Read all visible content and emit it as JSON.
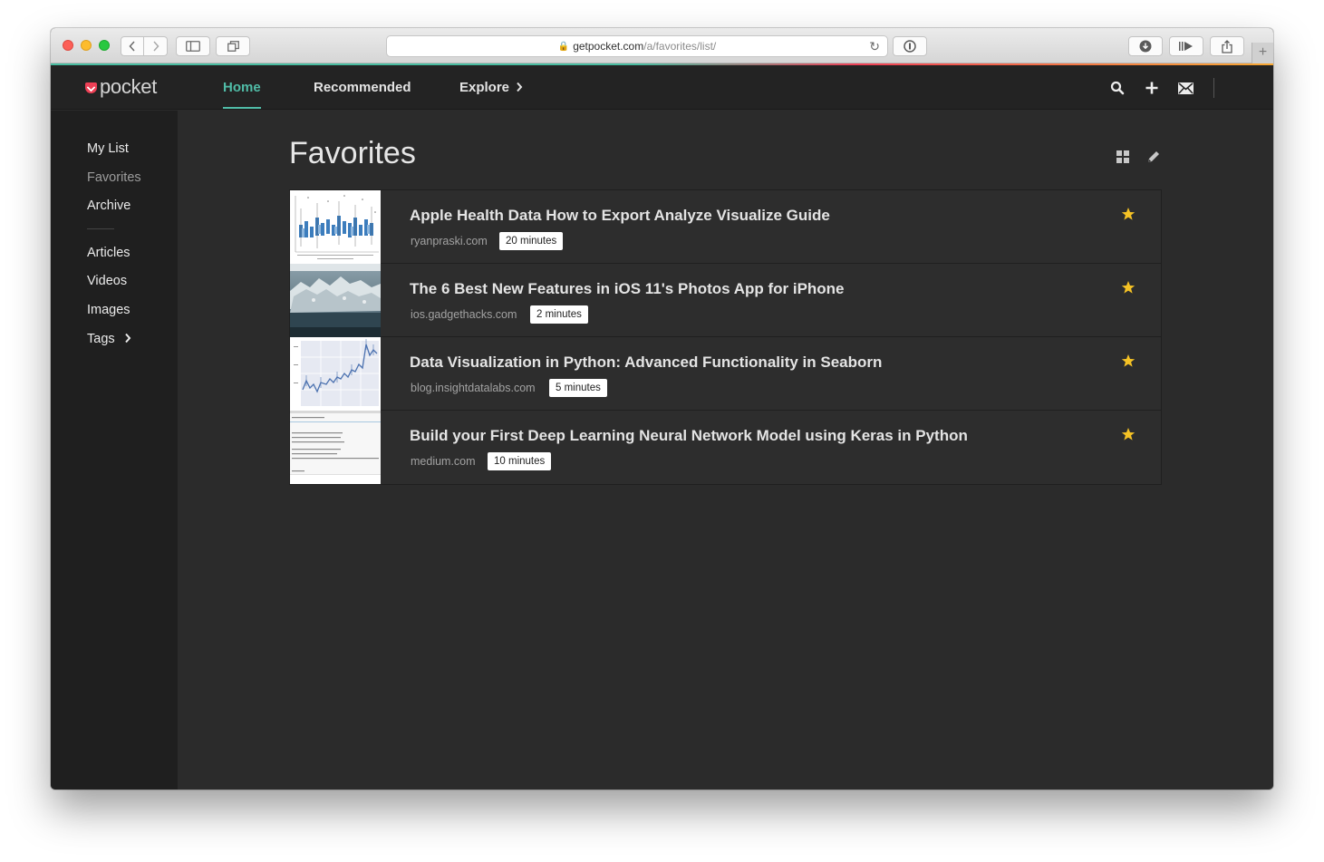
{
  "browser": {
    "url_host": "getpocket.com",
    "url_path": "/a/favorites/list/"
  },
  "header": {
    "logo_text": "pocket",
    "nav": [
      {
        "label": "Home",
        "active": true
      },
      {
        "label": "Recommended",
        "active": false
      },
      {
        "label": "Explore",
        "active": false
      }
    ],
    "icons": [
      "search-icon",
      "add-icon",
      "mail-icon"
    ]
  },
  "sidebar": {
    "primary": [
      {
        "label": "My List"
      },
      {
        "label": "Favorites",
        "selected": true
      },
      {
        "label": "Archive"
      }
    ],
    "filters": [
      {
        "label": "Articles"
      },
      {
        "label": "Videos"
      },
      {
        "label": "Images"
      },
      {
        "label": "Tags"
      }
    ]
  },
  "main": {
    "page_title": "Favorites",
    "items": [
      {
        "title": "Apple Health Data How to Export Analyze Visualize Guide",
        "domain": "ryanpraski.com",
        "read_time": "20 minutes",
        "favorited": true,
        "thumbnail": "boxplot-chart"
      },
      {
        "title": "The 6 Best New Features in iOS 11's Photos App for iPhone",
        "domain": "ios.gadgethacks.com",
        "read_time": "2 minutes",
        "favorited": true,
        "thumbnail": "photo"
      },
      {
        "title": "Data Visualization in Python: Advanced Functionality in Seaborn",
        "domain": "blog.insightdatalabs.com",
        "read_time": "5 minutes",
        "favorited": true,
        "thumbnail": "line-chart"
      },
      {
        "title": "Build your First Deep Learning Neural Network Model using Keras in Python",
        "domain": "medium.com",
        "read_time": "10 minutes",
        "favorited": true,
        "thumbnail": "code-output"
      }
    ]
  },
  "colors": {
    "accent": "#50bca7",
    "brand_red": "#ee4056",
    "star": "#f5c225",
    "header_bg": "#232323",
    "sidebar_bg": "#1f1f1f",
    "content_bg": "#2b2b2b"
  }
}
